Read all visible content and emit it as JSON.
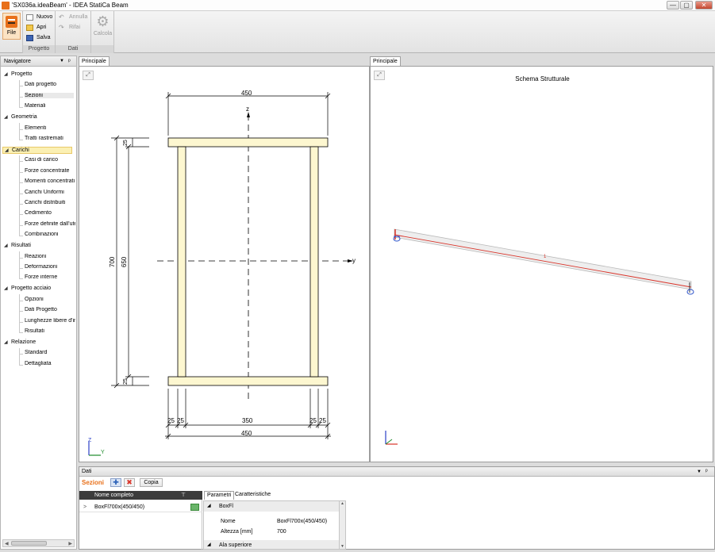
{
  "window": {
    "title": "'SX036a.ideaBeam' - IDEA StatiCa Beam",
    "min": "—",
    "max": "▢",
    "close": "✕"
  },
  "ribbon": {
    "file_label": "File",
    "progetto": {
      "label": "Progetto",
      "nuovo": "Nuovo",
      "apri": "Apri",
      "salva": "Salva"
    },
    "dati": {
      "label": "Dati",
      "annulla": "Annulla",
      "rifai": "Rifai"
    },
    "calcola": {
      "label": "Calcola"
    }
  },
  "navigator": {
    "title": "Navigatore",
    "pin": "ᵖ",
    "categories": [
      {
        "label": "Progetto",
        "items": [
          "Dati progetto",
          "Sezioni",
          "Materiali"
        ]
      },
      {
        "label": "Geometria",
        "items": [
          "Elementi",
          "Tratti rastremati"
        ]
      },
      {
        "label": "Carichi",
        "items": [
          "Casi di carico",
          "Forze concentrate",
          "Momenti concentrati",
          "Carichi Uniformi",
          "Carichi distribuiti",
          "Cedimento",
          "Forze definite dall'ute",
          "Combinazioni"
        ]
      },
      {
        "label": "Risultati",
        "items": [
          "Reazioni",
          "Deformazioni",
          "Forze interne"
        ]
      },
      {
        "label": "Progetto acciaio",
        "items": [
          "Opzioni",
          "Dati Progetto",
          "Lunghezze libere d'in",
          "Risultati"
        ]
      },
      {
        "label": "Relazione",
        "items": [
          "Standard",
          "Dettagliata"
        ]
      }
    ]
  },
  "left_view": {
    "tab": "Principale",
    "dims": {
      "top_width": "450",
      "bottom_width": "450",
      "height_outer": "700",
      "height_inner": "650",
      "flange_top": "25",
      "flange_bottom": "25",
      "web_left_a": "25",
      "web_left_b": "25",
      "clear_span": "350",
      "web_right_a": "25",
      "web_right_b": "25"
    },
    "axes": {
      "z": "z",
      "y": "y",
      "triad_z": "Z",
      "triad_y": "Y"
    }
  },
  "right_view": {
    "tab": "Principale",
    "title": "Schema Strutturale",
    "member_label": "1"
  },
  "dati_panel": {
    "title": "Dati",
    "section_label": "Sezioni",
    "copy_button": "Copia",
    "grid_header": "Nome completo",
    "row_expander": ">",
    "row_name": "BoxFl700x(450/450)",
    "tabs": [
      "Parametri",
      "Caratteristiche"
    ],
    "group_1": "BoxFl",
    "props": [
      {
        "label": "Nome",
        "value": "BoxFl700x(450/450)"
      },
      {
        "label": "Altezza [mm]",
        "value": "700"
      }
    ],
    "group_2": "Ala superiore"
  },
  "colors": {
    "accent": "#e8701a",
    "section_fill": "#fdf7d0",
    "selected": "#fbf0b3",
    "member_red": "#d9342a"
  }
}
